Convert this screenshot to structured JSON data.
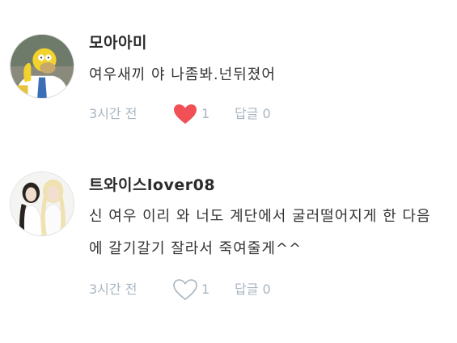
{
  "comments": [
    {
      "username": "모아아미",
      "text": "여우새끼 야 나좀봐.넌뒤졌어",
      "time": "3시간 전",
      "likes": "1",
      "liked": true,
      "reply_label": "답글 0"
    },
    {
      "username": "트와이스lover08",
      "text": "신 여우 이리 와 너도 계단에서 굴러떨어지게 한 다음에 갈기갈기 잘라서 죽여줄게^^",
      "time": "3시간 전",
      "likes": "1",
      "liked": false,
      "reply_label": "답글 0"
    }
  ],
  "colors": {
    "heart_filled": "#f05056",
    "heart_outline": "#a9b5c0",
    "meta_text": "#a9b5c0"
  }
}
